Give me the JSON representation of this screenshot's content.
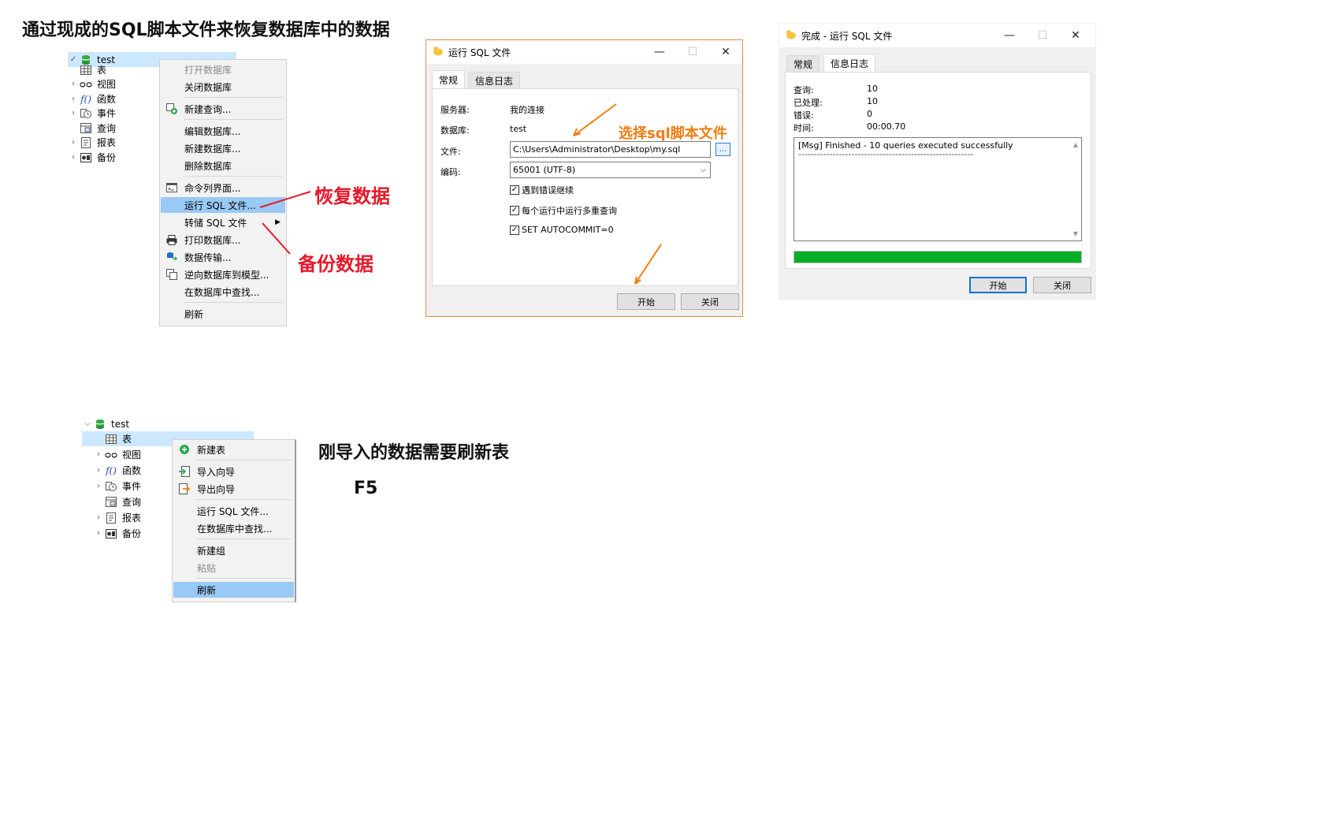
{
  "headings": {
    "main": "通过现成的SQL脚本文件来恢复数据库中的数据",
    "refresh_note": "刚导入的数据需要刷新表",
    "refresh_key": "F5"
  },
  "annotations": {
    "restore": "恢复数据",
    "backup": "备份数据",
    "choose_file": "选择sql脚本文件",
    "red": "#e8182b",
    "orange": "#f07d12"
  },
  "tree1": {
    "db": "test",
    "items": [
      "表",
      "视图",
      "函数",
      "事件",
      "查询",
      "报表",
      "备份"
    ]
  },
  "menu1": {
    "items": [
      {
        "label": "打开数据库",
        "disabled": true
      },
      {
        "label": "关闭数据库"
      },
      {
        "label": "新建查询..."
      },
      {
        "label": "编辑数据库..."
      },
      {
        "label": "新建数据库..."
      },
      {
        "label": "删除数据库"
      },
      {
        "label": "命令列界面..."
      },
      {
        "label": "运行 SQL 文件...",
        "highlight": true
      },
      {
        "label": "转储 SQL 文件"
      },
      {
        "label": "打印数据库..."
      },
      {
        "label": "数据传输..."
      },
      {
        "label": "逆向数据库到模型..."
      },
      {
        "label": "在数据库中查找..."
      },
      {
        "label": "刷新"
      }
    ]
  },
  "dialog1": {
    "title": "运行 SQL 文件",
    "tabs": [
      "常规",
      "信息日志"
    ],
    "server_label": "服务器:",
    "server_value": "我的连接",
    "db_label": "数据库:",
    "db_value": "test",
    "file_label": "文件:",
    "file_value": "C:\\Users\\Administrator\\Desktop\\my.sql",
    "browse": "...",
    "encoding_label": "编码:",
    "encoding_value": "65001 (UTF-8)",
    "options": [
      "遇到错误继续",
      "每个运行中运行多重查询",
      "SET AUTOCOMMIT=0"
    ],
    "start": "开始",
    "close": "关闭"
  },
  "dialog2": {
    "title": "完成 - 运行 SQL 文件",
    "tabs": [
      "常规",
      "信息日志"
    ],
    "stats": [
      {
        "label": "查询:",
        "value": "10"
      },
      {
        "label": "已处理:",
        "value": "10"
      },
      {
        "label": "错误:",
        "value": "0"
      },
      {
        "label": "时间:",
        "value": "00:00.70"
      }
    ],
    "log_line": "[Msg] Finished - 10 queries executed successfully",
    "log_sep": "--------------------------------------------------------",
    "progress": 1.0,
    "start": "开始",
    "close": "关闭"
  },
  "tree2": {
    "db": "test",
    "items": [
      "表",
      "视图",
      "函数",
      "事件",
      "查询",
      "报表",
      "备份"
    ]
  },
  "menu2": {
    "items": [
      {
        "label": "新建表"
      },
      {
        "label": "导入向导"
      },
      {
        "label": "导出向导"
      },
      {
        "label": "运行 SQL 文件..."
      },
      {
        "label": "在数据库中查找..."
      },
      {
        "label": "新建组"
      },
      {
        "label": "粘贴",
        "disabled": true
      },
      {
        "label": "刷新",
        "highlight": true
      }
    ]
  }
}
